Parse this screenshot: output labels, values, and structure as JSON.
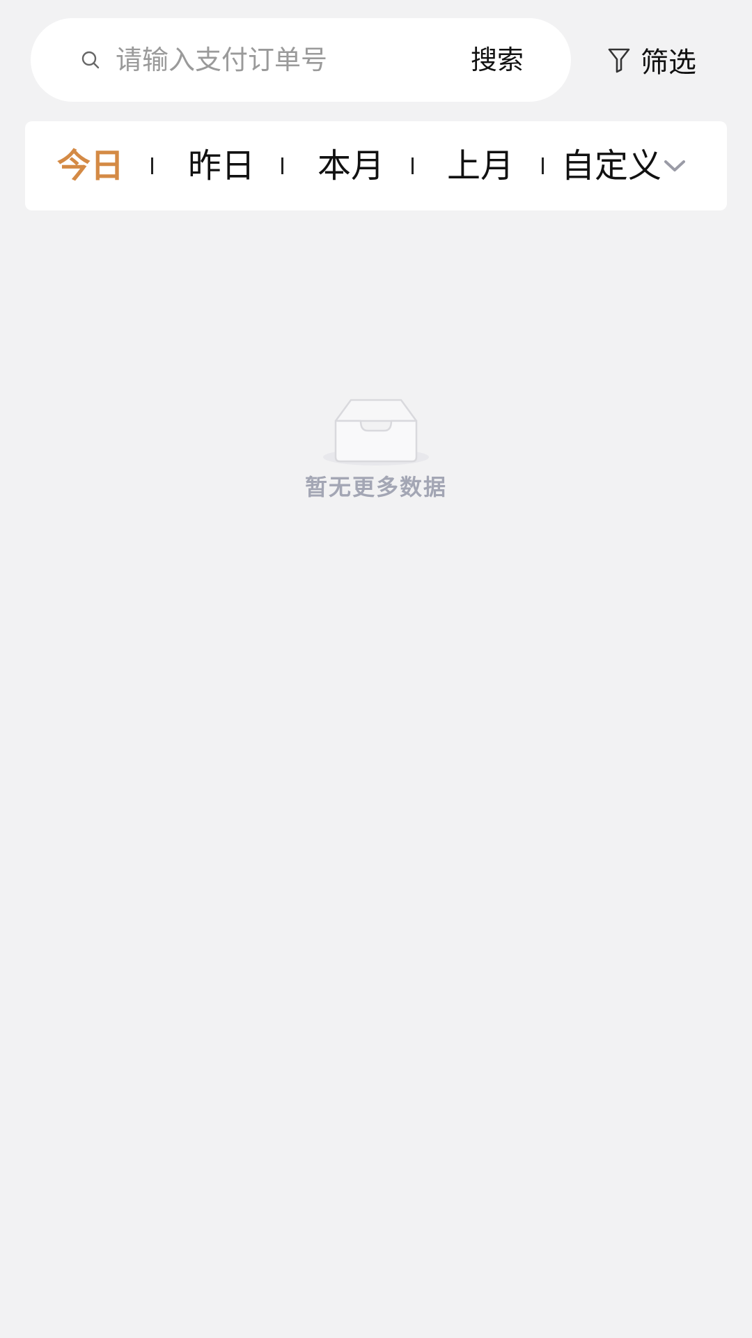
{
  "search": {
    "placeholder": "请输入支付订单号",
    "value": "",
    "button_label": "搜索",
    "icon": "search-icon"
  },
  "filter": {
    "label": "筛选",
    "icon": "filter-icon"
  },
  "tabs": {
    "items": [
      {
        "label": "今日",
        "active": true
      },
      {
        "label": "昨日",
        "active": false
      },
      {
        "label": "本月",
        "active": false
      },
      {
        "label": "上月",
        "active": false
      },
      {
        "label": "自定义",
        "active": false,
        "icon": "chevron-down-icon"
      }
    ]
  },
  "empty_state": {
    "message": "暂无更多数据",
    "icon": "empty-inbox-icon"
  },
  "colors": {
    "background": "#f2f2f3",
    "active_tab": "#d48a45",
    "muted_text": "#a3a6b4",
    "card": "#ffffff"
  }
}
